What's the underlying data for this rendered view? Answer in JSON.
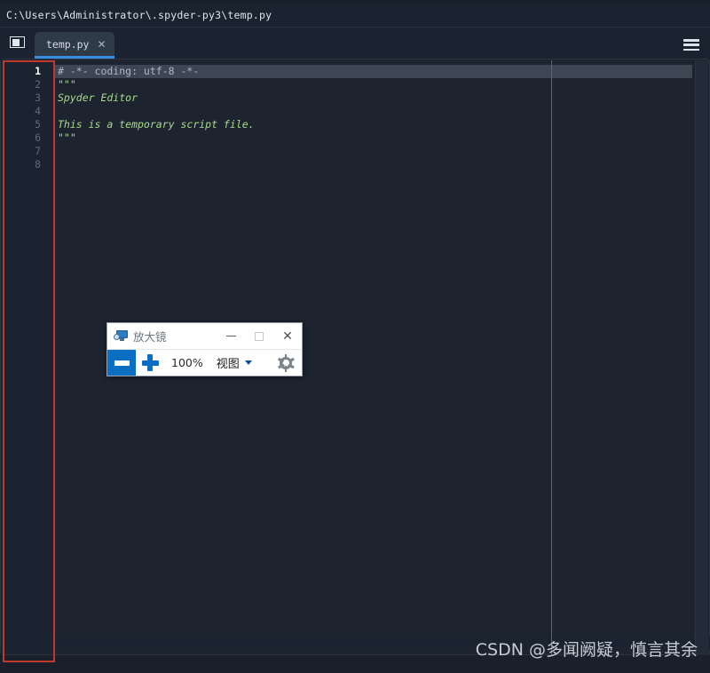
{
  "window": {
    "title_path": "C:\\Users\\Administrator\\.spyder-py3\\temp.py"
  },
  "tabbar": {
    "browse_icon": "folder-icon",
    "tab_label": "temp.py",
    "tab_close": "✕",
    "options_icon": "hamburger-menu-icon"
  },
  "editor": {
    "line_numbers": [
      "1",
      "2",
      "3",
      "4",
      "5",
      "6",
      "7",
      "8"
    ],
    "active_line": "1",
    "lines": [
      {
        "text": "# -*- coding: utf-8 -*-",
        "token": "comment"
      },
      {
        "text": "\"\"\"",
        "token": "string"
      },
      {
        "text": "Spyder Editor",
        "token": "string"
      },
      {
        "text": "",
        "token": "string"
      },
      {
        "text": "This is a temporary script file.",
        "token": "string"
      },
      {
        "text": "\"\"\"",
        "token": "string"
      },
      {
        "text": "",
        "token": "plain"
      },
      {
        "text": "",
        "token": "plain"
      }
    ],
    "colors": {
      "background": "#1d242f",
      "gutter": "#1b2230",
      "current_line": "#3e4654",
      "comment": "#aeb8c4",
      "string": "#a6da8c",
      "annotation_box": "#c0392b",
      "tab_accent": "#3a8ee0"
    }
  },
  "magnifier": {
    "app_icon": "magnifier-app-icon",
    "title": "放大镜",
    "minimize": "—",
    "maximize": "□",
    "close": "✕",
    "zoom_out_icon": "minus-icon",
    "zoom_in_icon": "plus-icon",
    "zoom_level": "100%",
    "view_menu_label": "视图",
    "settings_icon": "gear-icon",
    "accent_color": "#0a6fc2"
  },
  "watermark": {
    "text": "CSDN @多闻阙疑，慎言其余"
  }
}
